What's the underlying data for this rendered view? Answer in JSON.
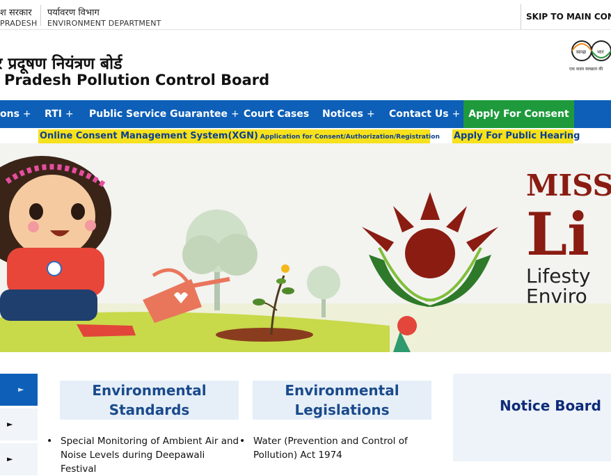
{
  "topbar": {
    "gov_hindi": "श सरकार",
    "gov_english": "PRADESH",
    "dept_hindi": "पर्यावरण विभाग",
    "dept_english": "ENVIRONMENT DEPARTMENT",
    "skip_label": "SKIP TO MAIN CONT"
  },
  "header": {
    "title_hindi": "र प्रदूषण नियंत्रण बोर्ड",
    "title_english": "Pradesh Pollution Control Board",
    "logo_text": "स्वच्छ",
    "logo_text2": "भार",
    "logo_tagline": "एक कदम स्वच्छता की"
  },
  "nav": {
    "items": [
      {
        "label": "ons",
        "plus": "+"
      },
      {
        "label": "RTI",
        "plus": "+"
      },
      {
        "label": "Public Service Guarantee",
        "plus": "+"
      },
      {
        "label": "Court Cases",
        "plus": ""
      },
      {
        "label": "Notices",
        "plus": "+"
      },
      {
        "label": "Contact Us",
        "plus": "+"
      }
    ],
    "apply_label": "Apply For Consent"
  },
  "sublinks": {
    "xgn_main": "Online Consent Management System(XGN)",
    "xgn_small": "Application for Consent/Authorization/Registration",
    "hearing": "Apply For Public Hearing"
  },
  "banner": {
    "mission_word": "MISS",
    "life_word": "Li",
    "lifestyle_line": "Lifesty",
    "environment_line": "Enviro"
  },
  "sections": {
    "standards": {
      "title_line1": "Environmental",
      "title_line2": "Standards",
      "item_line1": "Special Monitoring of Ambient Air and",
      "item_line2": "Noise Levels during Deepawali Festival"
    },
    "legislations": {
      "title_line1": "Environmental",
      "title_line2": "Legislations",
      "item_line1": "Water (Prevention and Control of",
      "item_line2": "Pollution) Act 1974"
    },
    "notice_board": {
      "title": "Notice Board"
    }
  },
  "side_tabs": {
    "arrow": "►"
  },
  "colors": {
    "nav_blue": "#0d5fb8",
    "apply_green": "#1e9a3c",
    "highlight_yellow": "#f7e11c",
    "section_title_blue": "#1a4a8c",
    "notice_title_navy": "#0e2b78",
    "banner_maroon": "#8a1c12"
  }
}
